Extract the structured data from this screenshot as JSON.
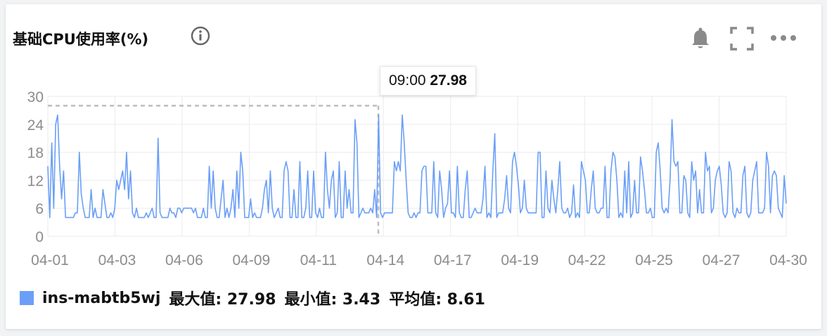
{
  "panel": {
    "title": "基础CPU使用率(%)",
    "icons": [
      "info-icon",
      "bell-icon",
      "expand-icon",
      "more-icon"
    ]
  },
  "tooltip": {
    "time": "09:00",
    "value": "27.98"
  },
  "legend": {
    "instance": "ins-mabtb5wj",
    "max_text": "最大值: 27.98",
    "min_text": "最小值: 3.43",
    "avg_text": "平均值: 8.61",
    "color": "#6b9ff7"
  },
  "chart_data": {
    "type": "line",
    "title": "基础CPU使用率(%)",
    "xlabel": "",
    "ylabel": "",
    "ylim": [
      0,
      30
    ],
    "yticks": [
      0,
      6,
      12,
      18,
      24,
      30
    ],
    "xticks": [
      "04-01",
      "04-03",
      "04-06",
      "04-09",
      "04-11",
      "04-14",
      "04-17",
      "04-19",
      "04-22",
      "04-25",
      "04-27",
      "04-30"
    ],
    "grid": true,
    "legend_position": "bottom-left",
    "series": [
      {
        "name": "ins-mabtb5wj",
        "color": "#6b9ff7",
        "values": [
          15,
          4,
          20,
          6,
          24,
          26,
          15,
          8,
          14,
          4,
          4,
          4,
          4,
          4,
          5,
          5,
          18,
          9,
          6,
          4,
          4,
          4,
          10,
          4,
          6,
          4,
          4,
          4,
          10,
          7,
          4,
          4,
          5,
          4,
          6,
          12,
          10,
          12,
          14,
          10,
          18,
          8,
          14,
          5,
          4,
          6,
          4,
          4,
          4,
          4,
          5,
          4,
          5,
          6,
          4,
          4,
          21,
          5,
          4,
          4,
          4,
          4,
          6,
          5,
          5,
          4,
          6,
          6,
          5,
          6,
          6,
          6,
          6,
          6,
          5,
          6,
          4,
          4,
          4,
          6,
          4,
          4,
          15,
          6,
          14,
          6,
          4,
          4,
          8,
          12,
          4,
          6,
          4,
          6,
          10,
          4,
          14,
          6,
          18,
          14,
          4,
          4,
          4,
          8,
          4,
          5,
          4,
          4,
          4,
          6,
          10,
          12,
          5,
          14,
          6,
          4,
          5,
          6,
          4,
          4,
          14,
          16,
          14,
          4,
          4,
          10,
          4,
          4,
          16,
          4,
          4,
          6,
          14,
          4,
          4,
          14,
          5,
          4,
          6,
          4,
          4,
          18,
          10,
          6,
          12,
          14,
          4,
          5,
          16,
          4,
          4,
          14,
          6,
          10,
          5,
          5,
          25,
          20,
          4,
          5,
          6,
          5,
          5,
          5,
          6,
          5,
          10,
          4,
          26,
          5,
          4,
          5,
          5,
          5,
          5,
          5,
          16,
          14,
          16,
          14,
          26,
          20,
          12,
          5,
          4,
          4,
          5,
          4,
          5,
          5,
          14,
          15,
          15,
          5,
          5,
          5,
          16,
          5,
          4,
          14,
          10,
          4,
          6,
          7,
          14,
          5,
          5,
          4,
          15,
          5,
          4,
          4,
          10,
          14,
          4,
          4,
          5,
          6,
          5,
          5,
          5,
          8,
          15,
          4,
          5,
          4,
          14,
          22,
          4,
          5,
          5,
          5,
          8,
          13,
          6,
          5,
          16,
          18,
          15,
          11,
          5,
          6,
          12,
          6,
          5,
          5,
          5,
          5,
          5,
          18,
          18,
          4,
          4,
          14,
          6,
          5,
          12,
          8,
          5,
          10,
          16,
          6,
          5,
          5,
          6,
          4,
          5,
          11,
          4,
          5,
          4,
          16,
          14,
          12,
          5,
          5,
          10,
          14,
          6,
          5,
          5,
          6,
          6,
          15,
          4,
          4,
          14,
          18,
          17,
          12,
          4,
          5,
          4,
          14,
          5,
          16,
          4,
          5,
          12,
          5,
          5,
          17,
          14,
          10,
          5,
          5,
          6,
          4,
          4,
          18,
          20,
          14,
          6,
          5,
          6,
          5,
          12,
          25,
          16,
          15,
          16,
          5,
          5,
          13,
          12,
          5,
          4,
          16,
          12,
          14,
          5,
          10,
          5,
          5,
          18,
          14,
          15,
          5,
          6,
          12,
          14,
          15,
          11,
          5,
          4,
          5,
          16,
          14,
          5,
          4,
          6,
          5,
          5,
          13,
          15,
          5,
          4,
          5,
          12,
          14,
          16,
          5,
          5,
          5,
          6,
          18,
          15,
          5,
          13,
          14,
          13,
          6,
          5,
          4,
          13,
          7
        ]
      }
    ]
  }
}
